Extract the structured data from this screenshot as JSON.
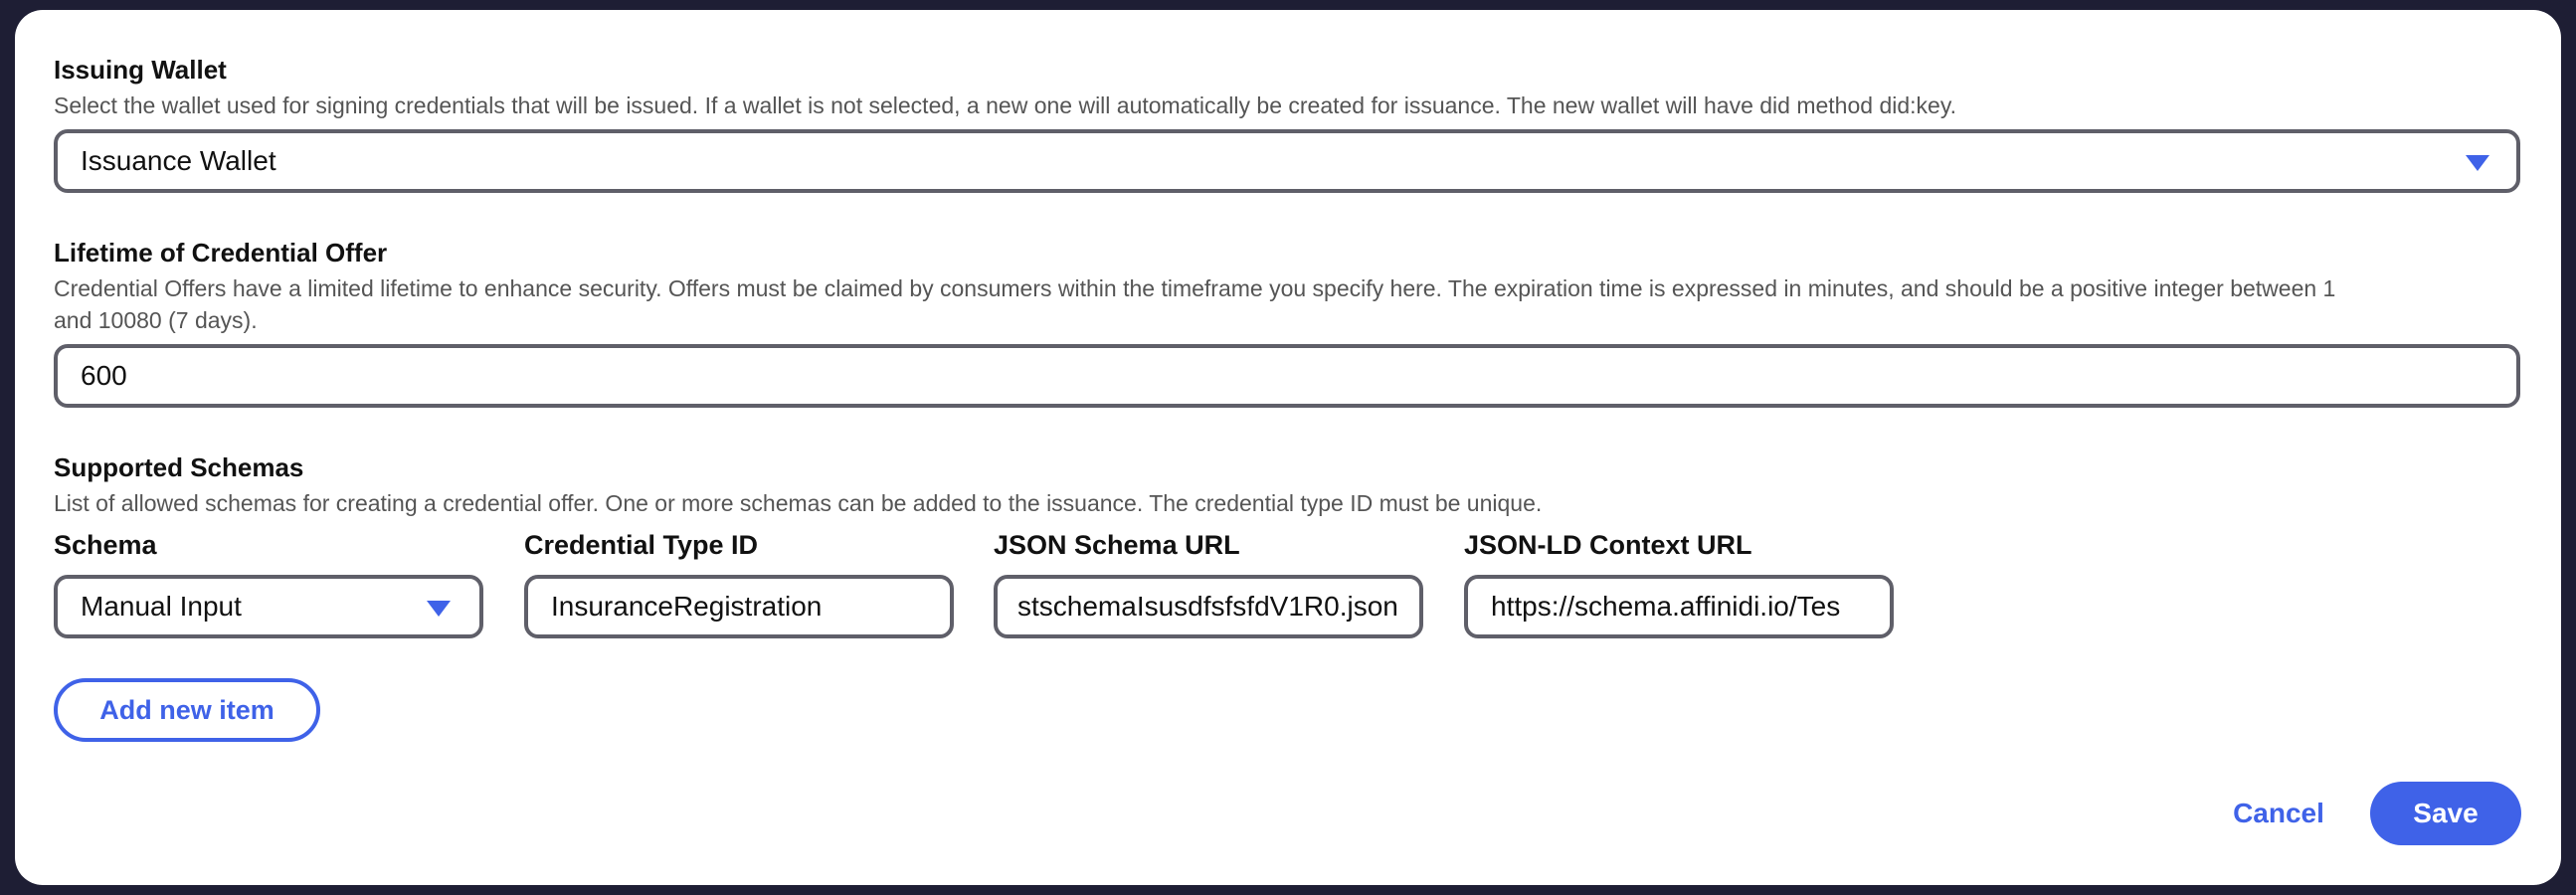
{
  "issuing_wallet": {
    "title": "Issuing Wallet",
    "description": "Select the wallet used for signing credentials that will be issued. If a wallet is not selected, a new one will automatically be created for issuance. The new wallet will have did method did:key.",
    "selected_value": "Issuance Wallet"
  },
  "lifetime": {
    "title": "Lifetime of Credential Offer",
    "description_line1": "Credential Offers have a limited lifetime to enhance security. Offers must be claimed by consumers within the timeframe you specify here. The expiration time is expressed in minutes, and should be a positive integer between 1",
    "description_line2": "and 10080 (7 days).",
    "value": "600"
  },
  "schemas": {
    "title": "Supported Schemas",
    "description": "List of allowed schemas for creating a credential offer. One or more schemas can be added to the issuance. The credential type ID must be unique.",
    "columns": {
      "schema": "Schema",
      "credential_type_id": "Credential Type ID",
      "json_schema_url": "JSON Schema URL",
      "jsonld_context_url": "JSON-LD Context URL"
    },
    "row": {
      "schema": "Manual Input",
      "credential_type_id": "InsuranceRegistration",
      "json_schema_url": "stschemaIsusdfsfsfdV1R0.json",
      "jsonld_context_url": "https://schema.affinidi.io/Tes"
    },
    "add_button": "Add new item"
  },
  "footer": {
    "cancel_label": "Cancel",
    "save_label": "Save"
  },
  "colors": {
    "accent": "#3f62e8",
    "border": "#5f5f69",
    "backdrop": "#1e1e34"
  },
  "icons": {
    "dropdown": "chevron-down-icon"
  }
}
